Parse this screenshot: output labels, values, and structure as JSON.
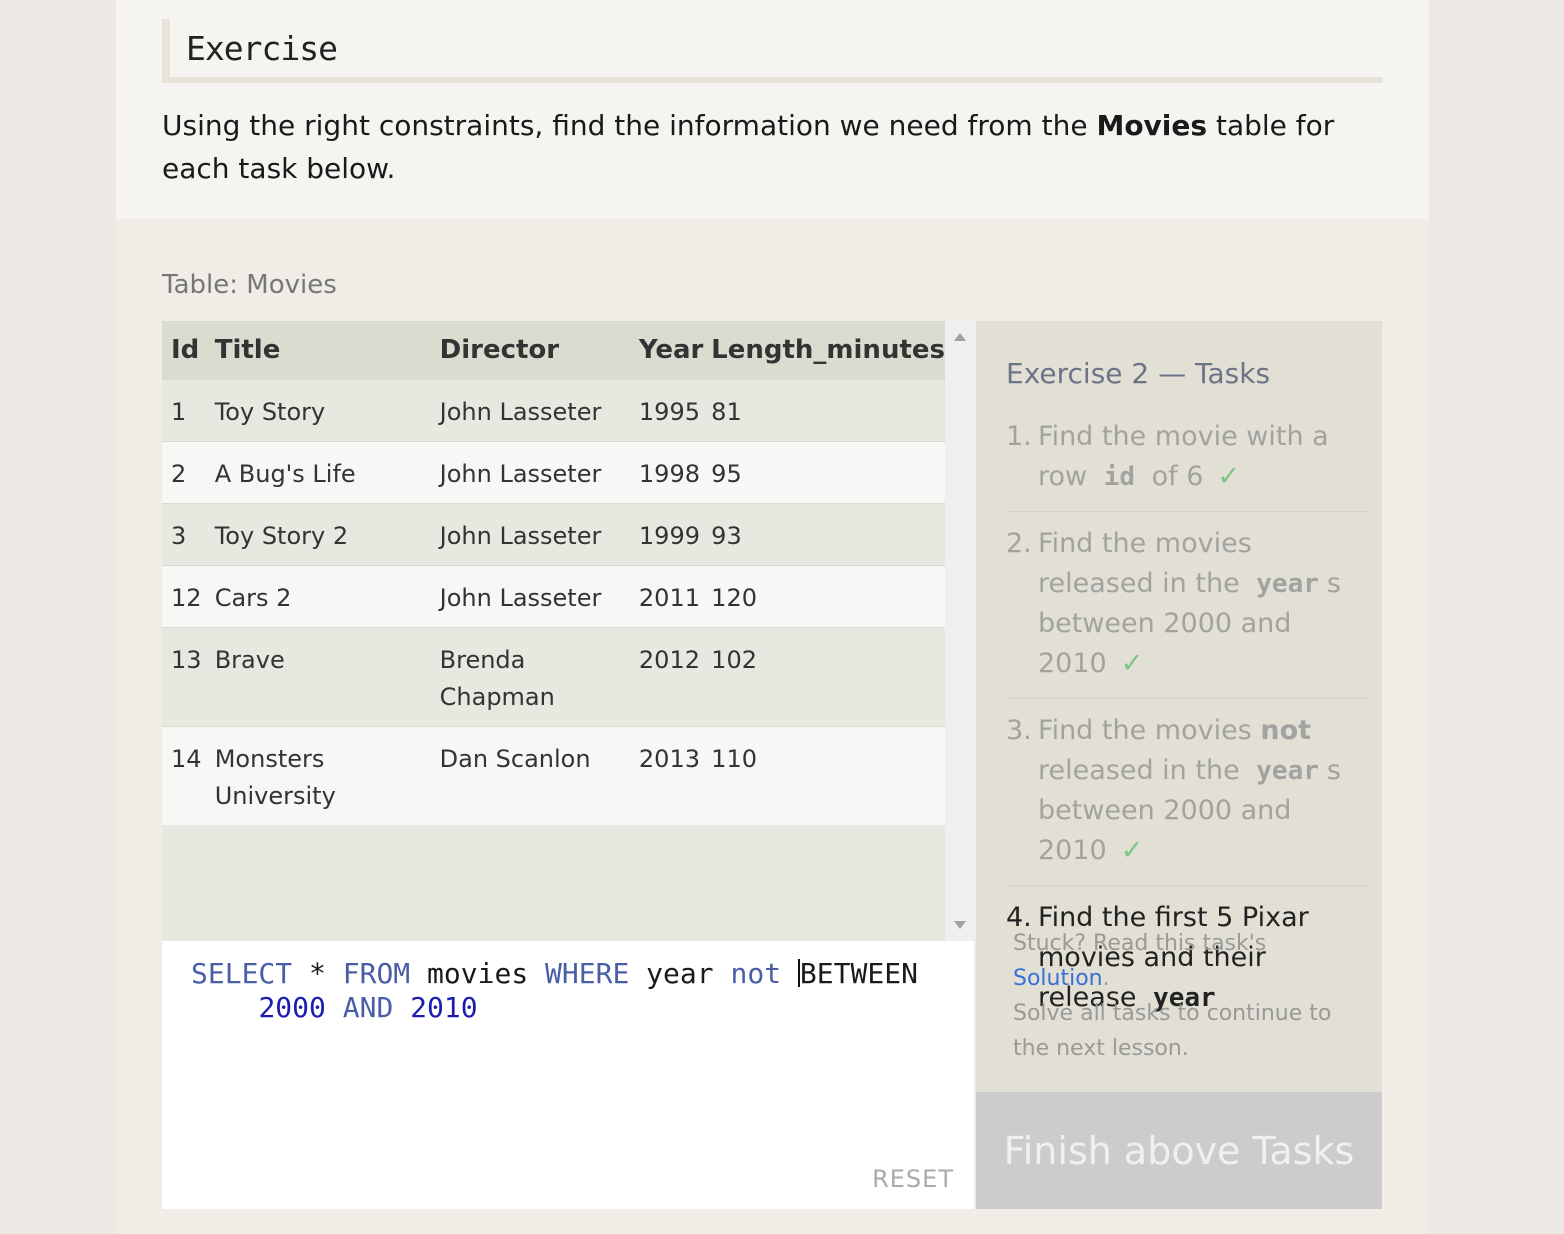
{
  "exercise": {
    "heading": "Exercise",
    "intro_prefix": "Using the right constraints, find the information we need from the ",
    "intro_bold": "Movies",
    "intro_suffix": " table for each task below."
  },
  "table": {
    "label": "Table: Movies",
    "columns": [
      "Id",
      "Title",
      "Director",
      "Year",
      "Length_minutes"
    ],
    "rows": [
      [
        "1",
        "Toy Story",
        "John Lasseter",
        "1995",
        "81"
      ],
      [
        "2",
        "A Bug's Life",
        "John Lasseter",
        "1998",
        "95"
      ],
      [
        "3",
        "Toy Story 2",
        "John Lasseter",
        "1999",
        "93"
      ],
      [
        "12",
        "Cars 2",
        "John Lasseter",
        "2011",
        "120"
      ],
      [
        "13",
        "Brave",
        "Brenda Chapman",
        "2012",
        "102"
      ],
      [
        "14",
        "Monsters University",
        "Dan Scanlon",
        "2013",
        "110"
      ]
    ]
  },
  "editor": {
    "line1": [
      {
        "t": "SELECT",
        "k": "kw"
      },
      {
        "t": " * ",
        "k": ""
      },
      {
        "t": "FROM",
        "k": "kw"
      },
      {
        "t": " movies ",
        "k": ""
      },
      {
        "t": "WHERE",
        "k": "kw"
      },
      {
        "t": " year ",
        "k": ""
      },
      {
        "t": "not",
        "k": "kw"
      },
      {
        "t": " ",
        "k": ""
      },
      {
        "t": "|",
        "k": "cursor"
      },
      {
        "t": "BETWEEN",
        "k": ""
      }
    ],
    "line2": [
      {
        "t": "    ",
        "k": ""
      },
      {
        "t": "2000",
        "k": "num"
      },
      {
        "t": " ",
        "k": ""
      },
      {
        "t": "AND",
        "k": "kw"
      },
      {
        "t": " ",
        "k": ""
      },
      {
        "t": "2010",
        "k": "num"
      }
    ],
    "reset_label": "RESET"
  },
  "tasks": {
    "title": "Exercise 2 — Tasks",
    "t1": {
      "num": "1.",
      "a": "Find the movie with a row ",
      "code": "id",
      "b": " of 6",
      "check": "✓"
    },
    "t2": {
      "num": "2.",
      "a": "Find the movies released in the ",
      "code": "year",
      "b": "s between 2000 and 2010",
      "check": "✓"
    },
    "t3": {
      "num": "3.",
      "a": "Find the movies ",
      "bold": "not",
      "b": " released in the ",
      "code": "year",
      "c": "s between 2000 and 2010",
      "check": "✓"
    },
    "t4": {
      "num": "4.",
      "a": "Find the first 5 Pixar movies and their release ",
      "code": "year"
    },
    "stuck_prefix": "Stuck? Read this task's ",
    "solution_link": "Solution",
    "stuck_suffix": ".",
    "solve_note": "Solve all tasks to continue to the next lesson.",
    "finish_label": "Finish above Tasks"
  }
}
